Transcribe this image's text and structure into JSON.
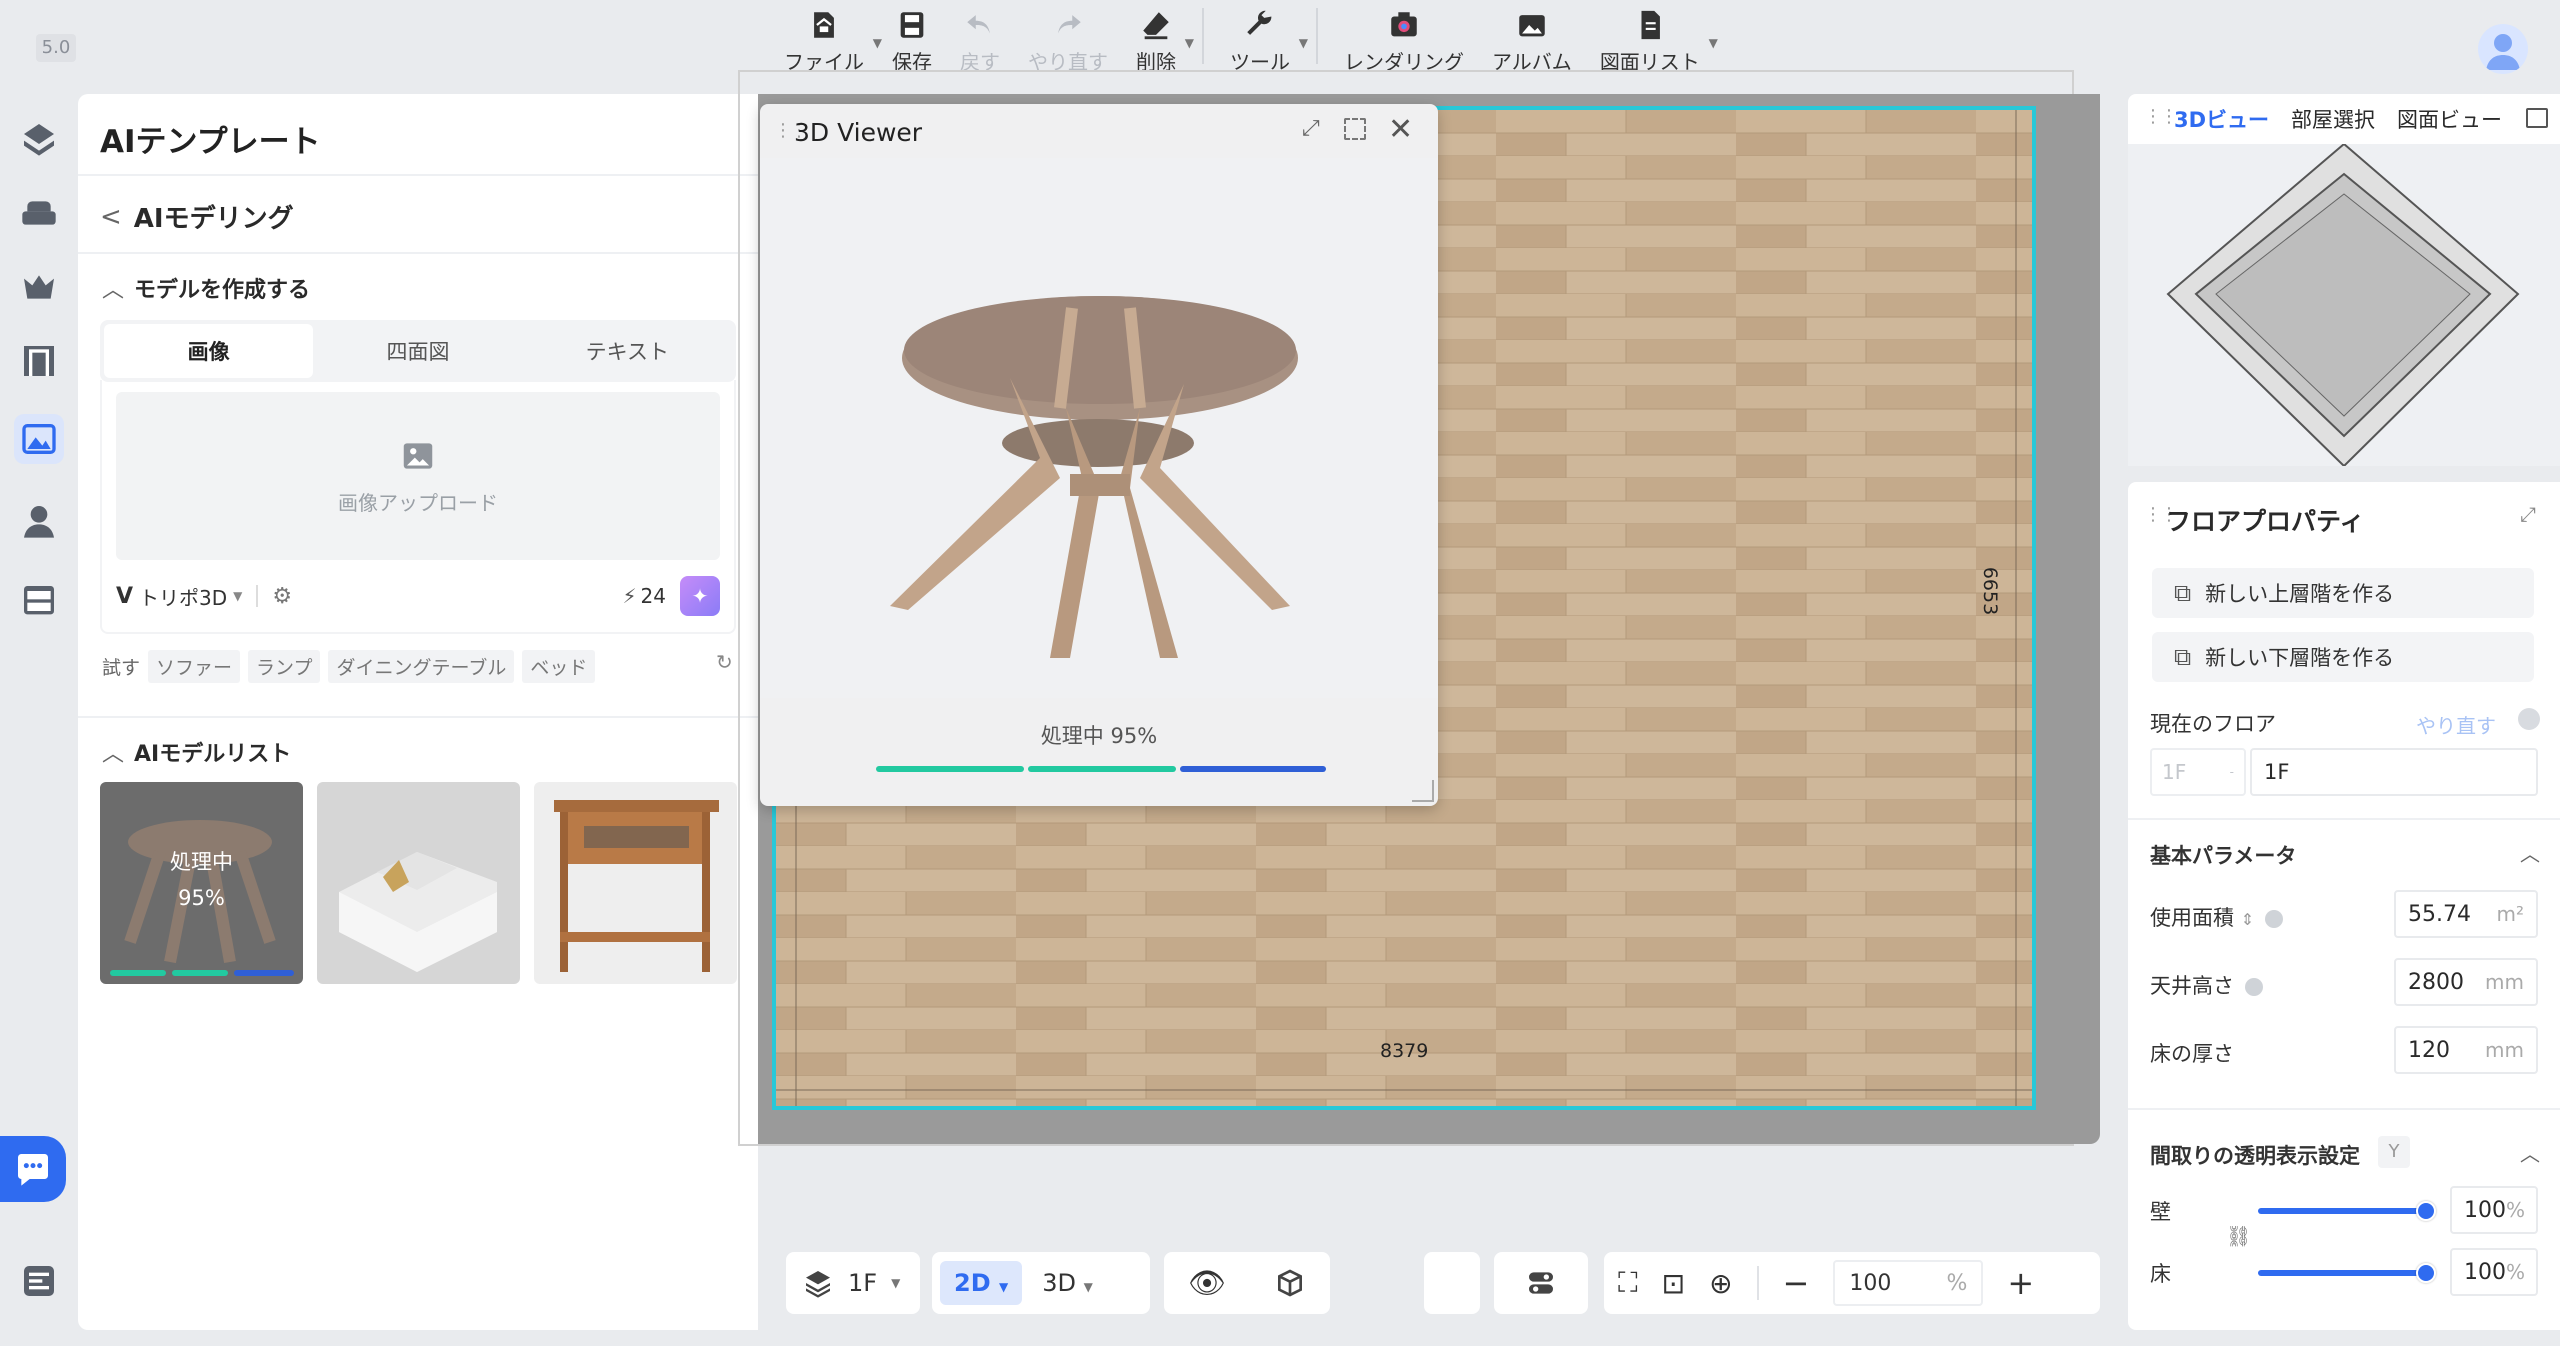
{
  "app": {
    "version": "5.0"
  },
  "toolbar": {
    "items": [
      {
        "label": "ファイル",
        "icon": "file-home-icon",
        "dropdown": true
      },
      {
        "label": "保存",
        "icon": "save-icon"
      },
      {
        "label": "戻す",
        "icon": "undo-icon",
        "disabled": true
      },
      {
        "label": "やり直す",
        "icon": "redo-icon",
        "disabled": true
      },
      {
        "label": "削除",
        "icon": "eraser-icon",
        "dropdown": true
      },
      {
        "label": "ツール",
        "icon": "wrench-icon",
        "dropdown": true
      },
      {
        "label": "レンダリング",
        "icon": "camera-icon"
      },
      {
        "label": "アルバム",
        "icon": "album-icon"
      },
      {
        "label": "図面リスト",
        "icon": "drawing-list-icon",
        "dropdown": true
      }
    ]
  },
  "left_panel": {
    "title": "AIテンプレート",
    "back_label": "AIモデリング",
    "create_section": "モデルを作成する",
    "tabs": [
      "画像",
      "四面図",
      "テキスト"
    ],
    "upload_label": "画像アップロード",
    "model_name": "トリポ3D",
    "credits": "24",
    "try_label": "試す",
    "try_chips": [
      "ソファー",
      "ランプ",
      "ダイニングテーブル",
      "ベッド"
    ],
    "list_section": "AIモデルリスト",
    "thumb_status": "処理中",
    "thumb_percent": "95%"
  },
  "viewer": {
    "title": "3D Viewer",
    "status": "処理中 95%",
    "progress": 0.95
  },
  "canvas": {
    "dim_horizontal": "8379",
    "dim_vertical": "6653"
  },
  "right_panel": {
    "tabs": [
      "3Dビュー",
      "部屋選択",
      "図面ビュー"
    ],
    "title": "フロアプロパティ",
    "btn_upper": "新しい上層階を作る",
    "btn_lower": "新しい下層階を作る",
    "current_floor_label": "現在のフロア",
    "redo_label": "やり直す",
    "floor_select": "1F",
    "floor_name": "1F",
    "basic_params": "基本パラメータ",
    "area_label": "使用面積",
    "area_value": "55.74",
    "area_unit": "m²",
    "ceiling_label": "天井高さ",
    "ceiling_value": "2800",
    "ceiling_unit": "mm",
    "floor_thick_label": "床の厚さ",
    "floor_thick_value": "120",
    "floor_thick_unit": "mm",
    "transparency_label": "間取りの透明表示設定",
    "transparency_key": "Y",
    "wall_label": "壁",
    "wall_value": "100",
    "floor_label": "床",
    "floor_value": "100",
    "percent": "%"
  },
  "bottom_bar": {
    "floor": "1F",
    "mode_2d": "2D",
    "mode_3d": "3D",
    "zoom": "100",
    "zoom_unit": "%"
  },
  "colors": {
    "accent": "#2f6bf0",
    "progress_green": "#22c9a0",
    "selection": "#28c8d8"
  }
}
